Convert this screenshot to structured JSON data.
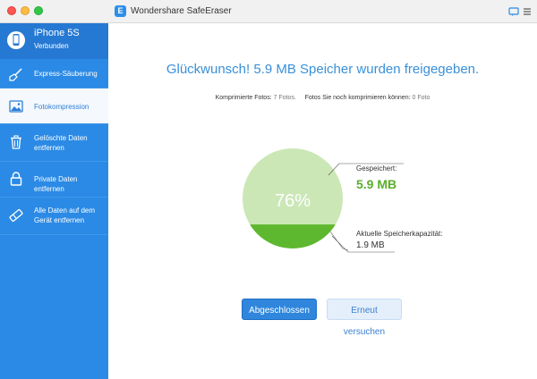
{
  "window": {
    "app_title": "Wondershare SafeEraser",
    "app_logo_letter": "E"
  },
  "device": {
    "name": "iPhone 5S",
    "status": "Verbunden"
  },
  "sidebar": {
    "items": [
      {
        "label": "Express-Säuberung",
        "icon": "broom-icon"
      },
      {
        "label": "Fotokompression",
        "icon": "photo-icon",
        "active": true
      },
      {
        "label": "Gelöschte Daten\nentfernen",
        "icon": "trash-icon"
      },
      {
        "label": "Private Daten entfernen",
        "icon": "lock-icon"
      },
      {
        "label": "Alle Daten auf dem\nGerät entfernen",
        "icon": "eraser-icon"
      }
    ]
  },
  "result": {
    "headline": "Glückwunsch! 5.9 MB Speicher wurden freigegeben.",
    "compressed_label": "Komprimierte Fotos:",
    "compressed_value": "7 Fotos.",
    "not_compressed_label": "Fotos Sie noch komprimieren können:",
    "not_compressed_value": "0 Foto",
    "percent": "76%",
    "saved_fraction": 0.76,
    "saved_label": "Gespeichert:",
    "saved_value": "5.9 MB",
    "capacity_label": "Aktuelle Speicherkapazität:",
    "capacity_value": "1.9 MB"
  },
  "buttons": {
    "done": "Abgeschlossen",
    "retry": "Erneut versuchen"
  },
  "colors": {
    "accent": "#2b8ae5",
    "headline": "#3a90d8",
    "saved": "#cbe7b6",
    "remaining": "#5db82f",
    "saved_text": "#5aaf2c"
  }
}
